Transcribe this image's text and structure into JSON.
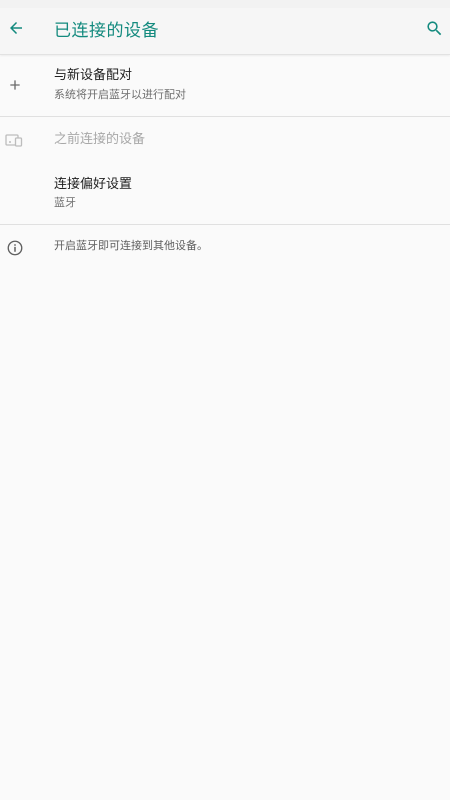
{
  "app_bar": {
    "title": "已连接的设备",
    "back_icon": "arrow-back-icon",
    "search_icon": "search-icon",
    "accent_color": "#138a7e"
  },
  "pair_new_device": {
    "icon": "plus-icon",
    "title": "与新设备配对",
    "summary": "系统将开启蓝牙以进行配对"
  },
  "previously_connected": {
    "icon": "devices-icon",
    "title": "之前连接的设备"
  },
  "connection_preferences": {
    "title": "连接偏好设置",
    "summary": "蓝牙"
  },
  "footer_info": {
    "icon": "info-icon",
    "text": "开启蓝牙即可连接到其他设备。"
  }
}
